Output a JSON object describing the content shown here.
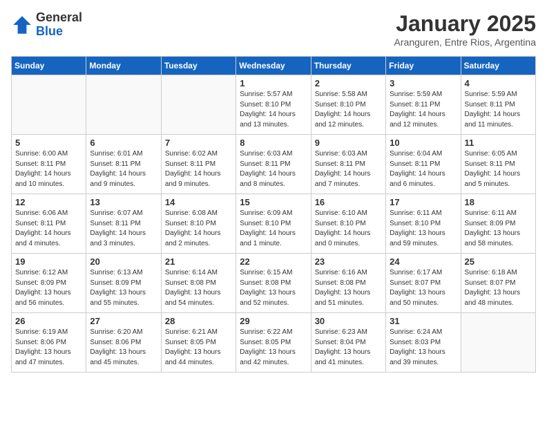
{
  "logo": {
    "general": "General",
    "blue": "Blue"
  },
  "title": "January 2025",
  "location": "Aranguren, Entre Rios, Argentina",
  "headers": [
    "Sunday",
    "Monday",
    "Tuesday",
    "Wednesday",
    "Thursday",
    "Friday",
    "Saturday"
  ],
  "weeks": [
    [
      {
        "num": "",
        "info": ""
      },
      {
        "num": "",
        "info": ""
      },
      {
        "num": "",
        "info": ""
      },
      {
        "num": "1",
        "info": "Sunrise: 5:57 AM\nSunset: 8:10 PM\nDaylight: 14 hours\nand 13 minutes."
      },
      {
        "num": "2",
        "info": "Sunrise: 5:58 AM\nSunset: 8:10 PM\nDaylight: 14 hours\nand 12 minutes."
      },
      {
        "num": "3",
        "info": "Sunrise: 5:59 AM\nSunset: 8:11 PM\nDaylight: 14 hours\nand 12 minutes."
      },
      {
        "num": "4",
        "info": "Sunrise: 5:59 AM\nSunset: 8:11 PM\nDaylight: 14 hours\nand 11 minutes."
      }
    ],
    [
      {
        "num": "5",
        "info": "Sunrise: 6:00 AM\nSunset: 8:11 PM\nDaylight: 14 hours\nand 10 minutes."
      },
      {
        "num": "6",
        "info": "Sunrise: 6:01 AM\nSunset: 8:11 PM\nDaylight: 14 hours\nand 9 minutes."
      },
      {
        "num": "7",
        "info": "Sunrise: 6:02 AM\nSunset: 8:11 PM\nDaylight: 14 hours\nand 9 minutes."
      },
      {
        "num": "8",
        "info": "Sunrise: 6:03 AM\nSunset: 8:11 PM\nDaylight: 14 hours\nand 8 minutes."
      },
      {
        "num": "9",
        "info": "Sunrise: 6:03 AM\nSunset: 8:11 PM\nDaylight: 14 hours\nand 7 minutes."
      },
      {
        "num": "10",
        "info": "Sunrise: 6:04 AM\nSunset: 8:11 PM\nDaylight: 14 hours\nand 6 minutes."
      },
      {
        "num": "11",
        "info": "Sunrise: 6:05 AM\nSunset: 8:11 PM\nDaylight: 14 hours\nand 5 minutes."
      }
    ],
    [
      {
        "num": "12",
        "info": "Sunrise: 6:06 AM\nSunset: 8:11 PM\nDaylight: 14 hours\nand 4 minutes."
      },
      {
        "num": "13",
        "info": "Sunrise: 6:07 AM\nSunset: 8:11 PM\nDaylight: 14 hours\nand 3 minutes."
      },
      {
        "num": "14",
        "info": "Sunrise: 6:08 AM\nSunset: 8:10 PM\nDaylight: 14 hours\nand 2 minutes."
      },
      {
        "num": "15",
        "info": "Sunrise: 6:09 AM\nSunset: 8:10 PM\nDaylight: 14 hours\nand 1 minute."
      },
      {
        "num": "16",
        "info": "Sunrise: 6:10 AM\nSunset: 8:10 PM\nDaylight: 14 hours\nand 0 minutes."
      },
      {
        "num": "17",
        "info": "Sunrise: 6:11 AM\nSunset: 8:10 PM\nDaylight: 13 hours\nand 59 minutes."
      },
      {
        "num": "18",
        "info": "Sunrise: 6:11 AM\nSunset: 8:09 PM\nDaylight: 13 hours\nand 58 minutes."
      }
    ],
    [
      {
        "num": "19",
        "info": "Sunrise: 6:12 AM\nSunset: 8:09 PM\nDaylight: 13 hours\nand 56 minutes."
      },
      {
        "num": "20",
        "info": "Sunrise: 6:13 AM\nSunset: 8:09 PM\nDaylight: 13 hours\nand 55 minutes."
      },
      {
        "num": "21",
        "info": "Sunrise: 6:14 AM\nSunset: 8:08 PM\nDaylight: 13 hours\nand 54 minutes."
      },
      {
        "num": "22",
        "info": "Sunrise: 6:15 AM\nSunset: 8:08 PM\nDaylight: 13 hours\nand 52 minutes."
      },
      {
        "num": "23",
        "info": "Sunrise: 6:16 AM\nSunset: 8:08 PM\nDaylight: 13 hours\nand 51 minutes."
      },
      {
        "num": "24",
        "info": "Sunrise: 6:17 AM\nSunset: 8:07 PM\nDaylight: 13 hours\nand 50 minutes."
      },
      {
        "num": "25",
        "info": "Sunrise: 6:18 AM\nSunset: 8:07 PM\nDaylight: 13 hours\nand 48 minutes."
      }
    ],
    [
      {
        "num": "26",
        "info": "Sunrise: 6:19 AM\nSunset: 8:06 PM\nDaylight: 13 hours\nand 47 minutes."
      },
      {
        "num": "27",
        "info": "Sunrise: 6:20 AM\nSunset: 8:06 PM\nDaylight: 13 hours\nand 45 minutes."
      },
      {
        "num": "28",
        "info": "Sunrise: 6:21 AM\nSunset: 8:05 PM\nDaylight: 13 hours\nand 44 minutes."
      },
      {
        "num": "29",
        "info": "Sunrise: 6:22 AM\nSunset: 8:05 PM\nDaylight: 13 hours\nand 42 minutes."
      },
      {
        "num": "30",
        "info": "Sunrise: 6:23 AM\nSunset: 8:04 PM\nDaylight: 13 hours\nand 41 minutes."
      },
      {
        "num": "31",
        "info": "Sunrise: 6:24 AM\nSunset: 8:03 PM\nDaylight: 13 hours\nand 39 minutes."
      },
      {
        "num": "",
        "info": ""
      }
    ]
  ]
}
